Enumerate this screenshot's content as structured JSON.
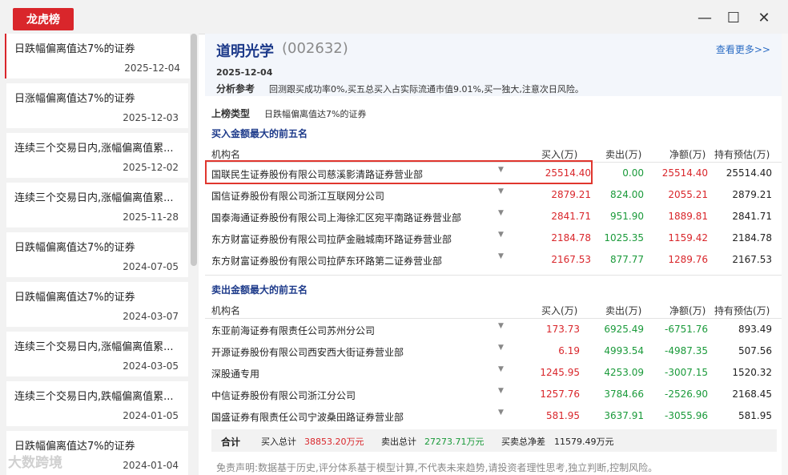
{
  "window": {
    "tab_label": "龙虎榜",
    "minimize": "—",
    "maximize": "☐",
    "close": "✕"
  },
  "sidebar": {
    "items": [
      {
        "title": "日跌幅偏离值达7%的证券",
        "date": "2025-12-04"
      },
      {
        "title": "日涨幅偏离值达7%的证券",
        "date": "2025-12-03"
      },
      {
        "title": "连续三个交易日内,涨幅偏离值累...",
        "date": "2025-12-02"
      },
      {
        "title": "连续三个交易日内,涨幅偏离值累...",
        "date": "2025-11-28"
      },
      {
        "title": "日跌幅偏离值达7%的证券",
        "date": "2024-07-05"
      },
      {
        "title": "日跌幅偏离值达7%的证券",
        "date": "2024-03-07"
      },
      {
        "title": "连续三个交易日内,涨幅偏离值累...",
        "date": "2024-03-05"
      },
      {
        "title": "连续三个交易日内,跌幅偏离值累...",
        "date": "2024-01-05"
      },
      {
        "title": "日跌幅偏离值达7%的证券",
        "date": "2024-01-04"
      }
    ]
  },
  "stock": {
    "name": "道明光学",
    "code": "(002632)",
    "more": "查看更多>>",
    "date": "2025-12-04"
  },
  "analysis": {
    "label": "分析参考",
    "text": "回测跟买成功率0%,买五总买入占实际流通市值9.01%,买一独大,注意次日风险。"
  },
  "list_type": {
    "label": "上榜类型",
    "value": "日跌幅偏离值达7%的证券"
  },
  "columns": {
    "inst": "机构名",
    "buy": "买入(万)",
    "sell": "卖出(万)",
    "net": "净额(万)",
    "hold": "持有预估(万)"
  },
  "buy_section": {
    "title": "买入金额最大的前五名",
    "rows": [
      {
        "inst": "国联民生证券股份有限公司慈溪影清路证券营业部",
        "buy": "25514.40",
        "sell": "0.00",
        "net": "25514.40",
        "hold": "25514.40"
      },
      {
        "inst": "国信证券股份有限公司浙江互联网分公司",
        "buy": "2879.21",
        "sell": "824.00",
        "net": "2055.21",
        "hold": "2879.21"
      },
      {
        "inst": "国泰海通证券股份有限公司上海徐汇区宛平南路证券营业部",
        "buy": "2841.71",
        "sell": "951.90",
        "net": "1889.81",
        "hold": "2841.71"
      },
      {
        "inst": "东方财富证券股份有限公司拉萨金融城南环路证券营业部",
        "buy": "2184.78",
        "sell": "1025.35",
        "net": "1159.42",
        "hold": "2184.78"
      },
      {
        "inst": "东方财富证券股份有限公司拉萨东环路第二证券营业部",
        "buy": "2167.53",
        "sell": "877.77",
        "net": "1289.76",
        "hold": "2167.53"
      }
    ]
  },
  "sell_section": {
    "title": "卖出金额最大的前五名",
    "rows": [
      {
        "inst": "东亚前海证券有限责任公司苏州分公司",
        "buy": "173.73",
        "sell": "6925.49",
        "net": "-6751.76",
        "hold": "893.49"
      },
      {
        "inst": "开源证券股份有限公司西安西大街证券营业部",
        "buy": "6.19",
        "sell": "4993.54",
        "net": "-4987.35",
        "hold": "507.56"
      },
      {
        "inst": "深股通专用",
        "buy": "1245.95",
        "sell": "4253.09",
        "net": "-3007.15",
        "hold": "1520.32"
      },
      {
        "inst": "中信证券股份有限公司浙江分公司",
        "buy": "1257.76",
        "sell": "3784.66",
        "net": "-2526.90",
        "hold": "2168.45"
      },
      {
        "inst": "国盛证券有限责任公司宁波桑田路证券营业部",
        "buy": "581.95",
        "sell": "3637.91",
        "net": "-3055.96",
        "hold": "581.95"
      }
    ]
  },
  "total": {
    "label": "合计",
    "buy_label": "买入总计",
    "buy_value": "38853.20万元",
    "sell_label": "卖出总计",
    "sell_value": "27273.71万元",
    "net_label": "买卖总净差",
    "net_value": "11579.49万元"
  },
  "disclaimer": "免责声明:数据基于历史,评分体系基于模型计算,不代表未来趋势,请投资者理性思考,独立判断,控制风险。",
  "watermark": "大数跨境",
  "colors": {
    "accent_red": "#d9262b",
    "buy_red": "#d9262b",
    "sell_green": "#1a9a3a",
    "title_blue": "#1d3a8a"
  }
}
